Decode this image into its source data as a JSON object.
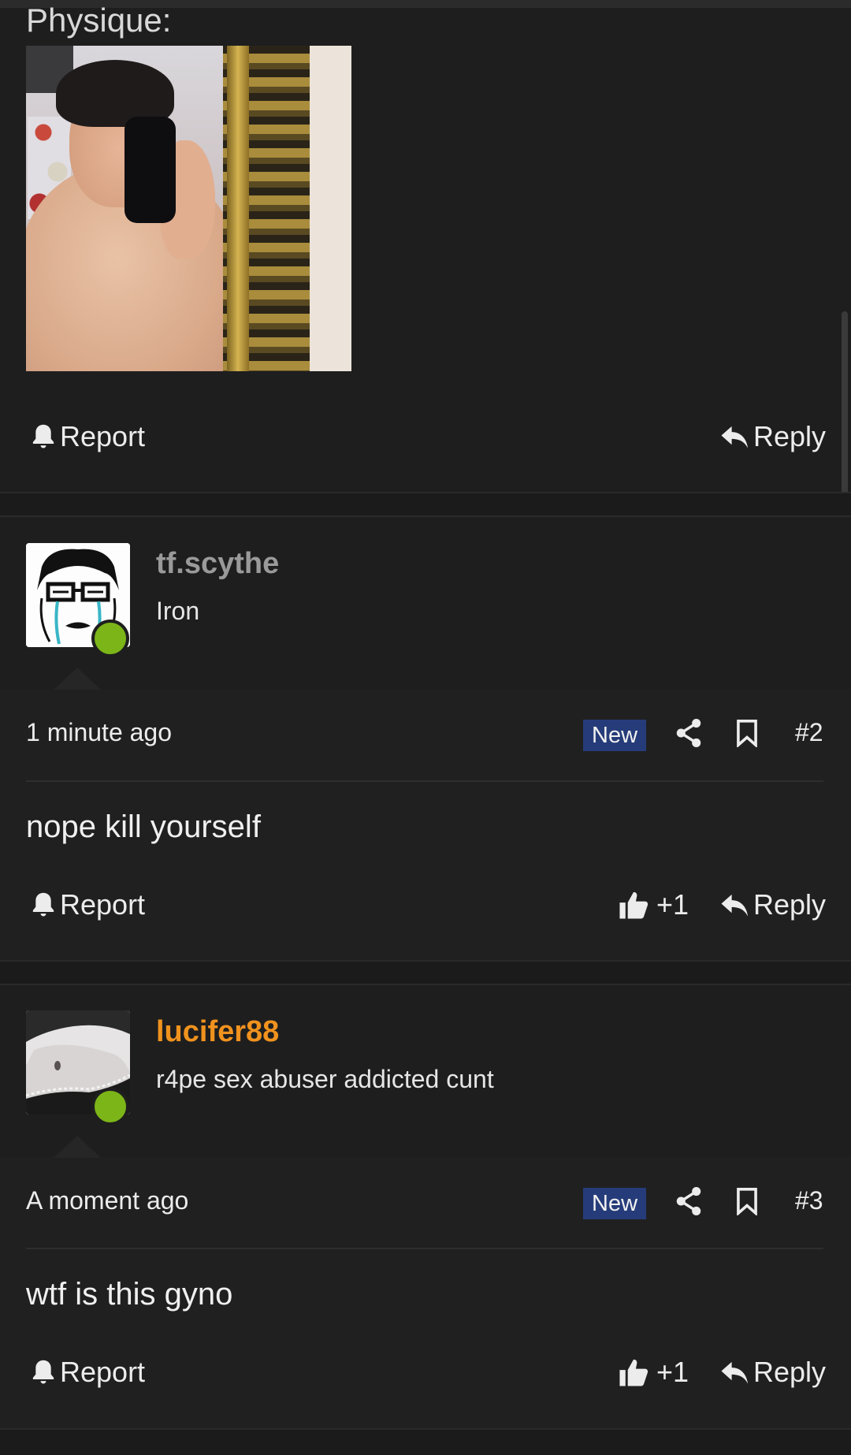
{
  "top_post": {
    "section_label": "Physique:",
    "report_label": "Report",
    "reply_label": "Reply"
  },
  "posts": [
    {
      "username": "tf.scythe",
      "username_color": "#9a9a9a",
      "user_title": "Iron",
      "timestamp": "1 minute ago",
      "badge": "New",
      "post_number": "#2",
      "body": "nope kill yourself",
      "like_count": "+1",
      "report_label": "Report",
      "reply_label": "Reply"
    },
    {
      "username": "lucifer88",
      "username_color": "#f0921e",
      "user_title": "r4pe sex abuser addicted cunt",
      "timestamp": "A moment ago",
      "badge": "New",
      "post_number": "#3",
      "body": "wtf is this gyno",
      "like_count": "+1",
      "report_label": "Report",
      "reply_label": "Reply"
    }
  ],
  "colors": {
    "background": "#1e1e1e",
    "badge_bg": "#263c7a",
    "online": "#7cb518"
  }
}
